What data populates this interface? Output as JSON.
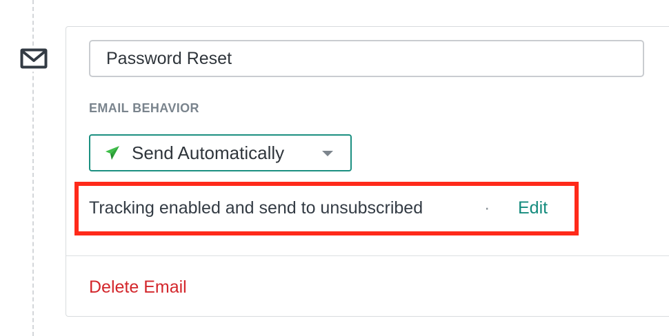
{
  "email": {
    "name_value": "Password Reset",
    "name_placeholder": "",
    "icon": "envelope-icon"
  },
  "behavior": {
    "section_label": "EMAIL BEHAVIOR",
    "selected": "Send Automatically",
    "icon": "paper-plane-icon",
    "icon_color": "#3fbf4a"
  },
  "tracking": {
    "summary": "Tracking enabled and send to unsubscribed",
    "separator": "·",
    "edit_label": "Edit"
  },
  "actions": {
    "delete_label": "Delete Email"
  },
  "colors": {
    "accent": "#148b7d",
    "danger": "#d3262b",
    "highlight": "#ff2a1a"
  }
}
